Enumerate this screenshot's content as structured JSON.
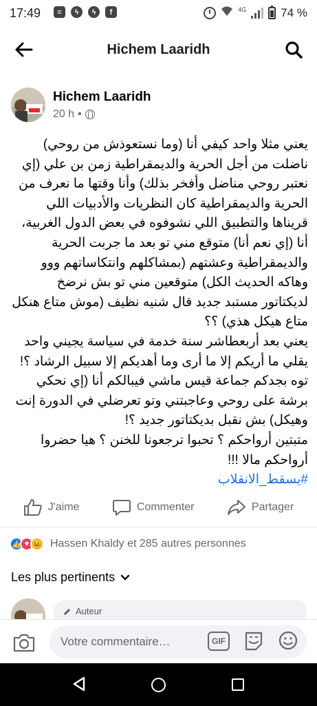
{
  "status_bar": {
    "time": "17:49",
    "network": "4G",
    "battery": "74 %",
    "notification_icons": [
      "message-icon",
      "messenger-icon",
      "messenger-icon",
      "facebook-icon"
    ]
  },
  "header": {
    "title": "Hichem Laaridh"
  },
  "post": {
    "author": "Hichem Laaridh",
    "time": "20 h",
    "separator": "•",
    "paragraphs": [
      "يعني مثلا واحد كيفي أنا (وما نستعوذش من روحي) ناضلت من أجل الحرية والديمقراطية زمن بن علي (إي نعتبر روحي مناضل وأفخر بذلك) وأنا وقتها ما نعرف من الحرية والديمقراطية كان النظريات والأدبيات اللي قريناها والتطبيق اللي نشوفوه في بعض الدول الغربية، أنا (إي نعم أنا) متوقع مني تو بعد ما جربت الحرية والديمقراطية وعشتهم (بمشاكلهم وانتكاساتهم ووو وهاكه الحديث الكل) متوقعين مني تو بش نرضخ لديكتاتور مستبد جديد قال شنيه نظيف (موش متاع هنكل متاع هيكل هذي) ؟؟",
      "يعني بعد أربعطاشر سنة خدمة في سياسة يجيني واحد يقلي ما أريكم إلا ما أرى وما أهديكم إلا سبيل الرشاد ؟! توه بجدكم جماعة قيس ماشي فيبالكم أنا (إي نحكي برشة على روحي وعاجبتني وتو تعرضلي في الدورة إنت وهيكل) بش نقبل بديكتاتور جديد ؟!",
      "متبتين أرواحكم ؟ تحبوا ترجعونا للخنن ؟ هيا حضروا أرواحكم مالا !!!"
    ],
    "hashtag": "#يسقط_الانقلاب"
  },
  "actions": {
    "like": "J'aime",
    "comment": "Commenter",
    "share": "Partager"
  },
  "reactions": {
    "text": "Hassen Khaldy et 285 autres personnes",
    "colors": {
      "like": "#1877f2",
      "love": "#f33e58",
      "haha": "#f7b125"
    }
  },
  "comments_filter": {
    "label": "Les plus pertinents"
  },
  "comment_preview": {
    "badge": "Auteur"
  },
  "composer": {
    "placeholder": "Votre commentaire…",
    "gif_label": "GIF"
  },
  "colors": {
    "hashtag": "#216fdb",
    "secondary_text": "#65676b"
  }
}
